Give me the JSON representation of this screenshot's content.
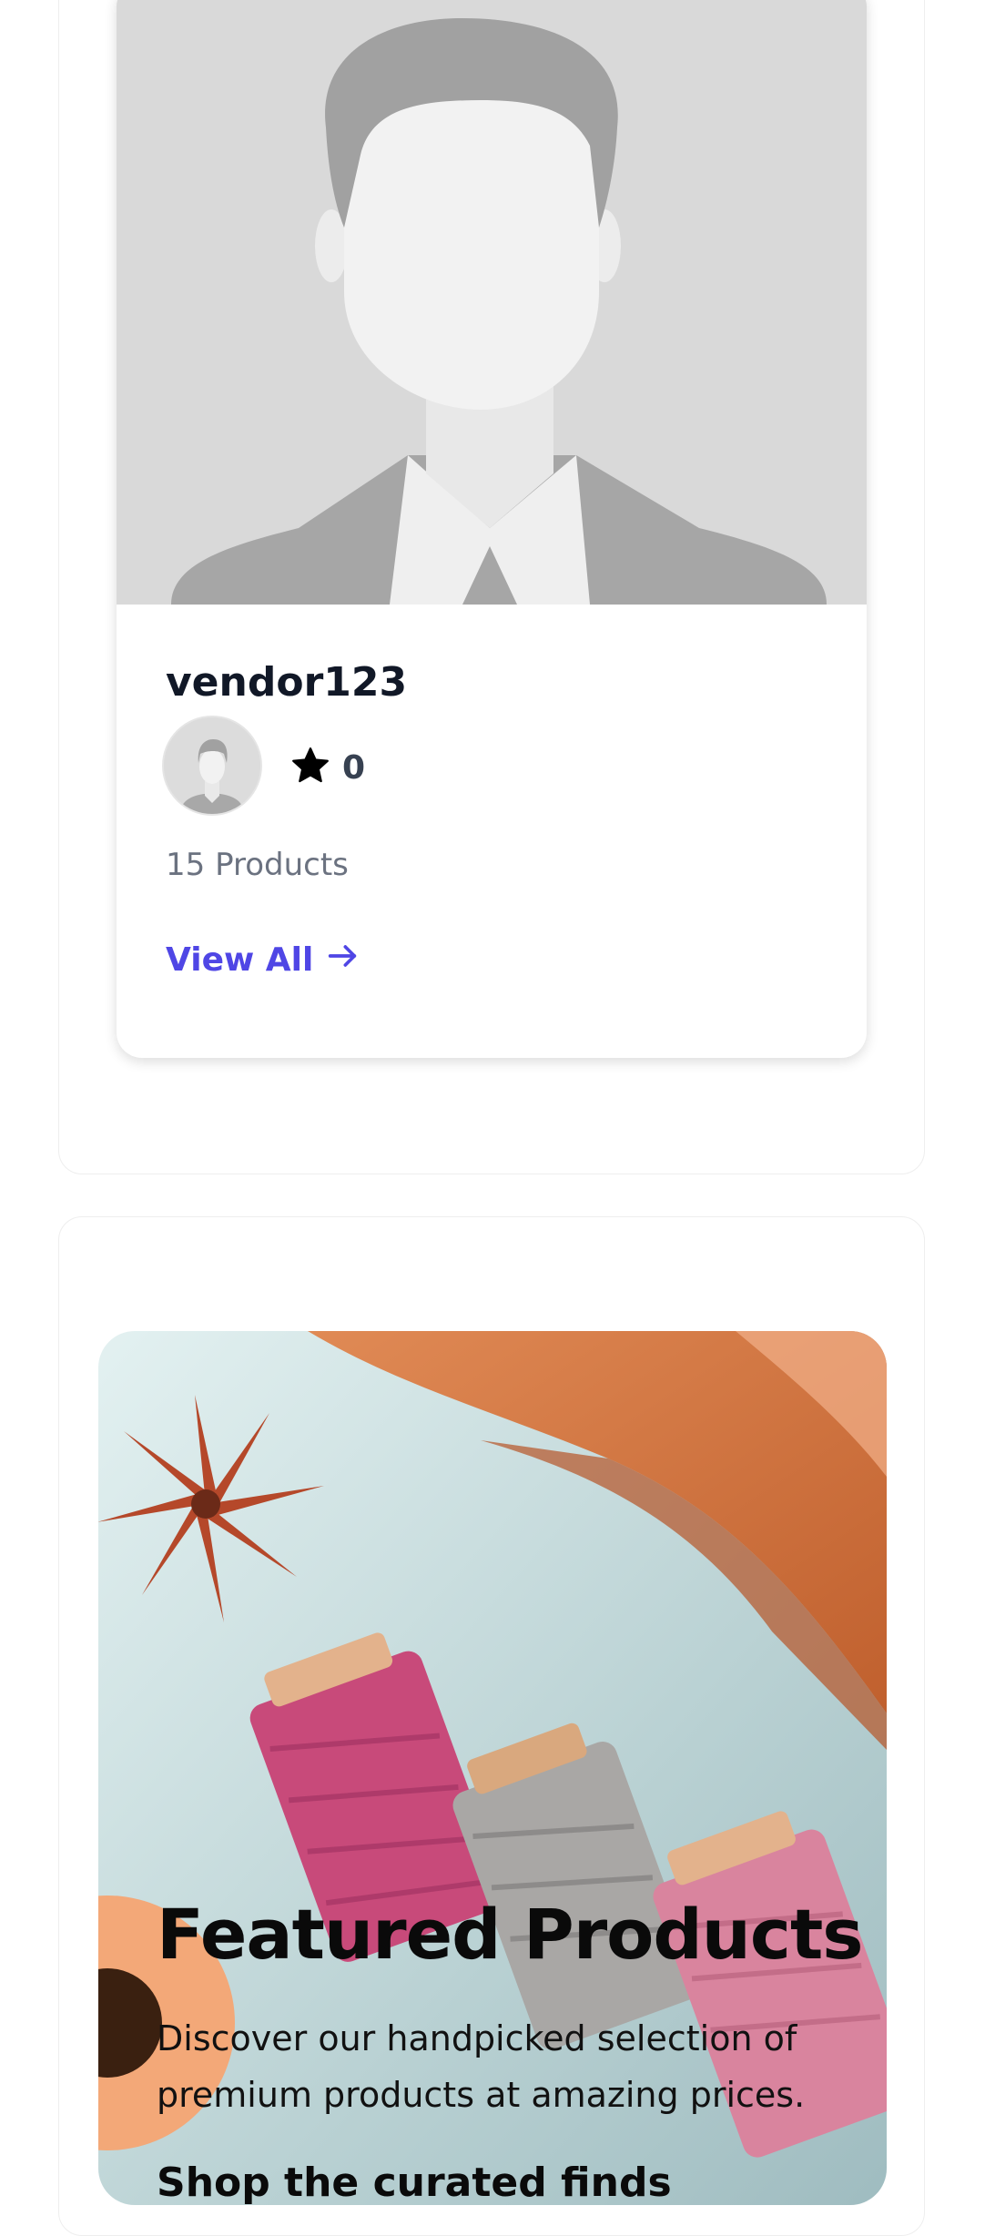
{
  "vendor": {
    "name": "vendor123",
    "rating": "0",
    "products": "15 Products",
    "view_all_label": "View All"
  },
  "featured": {
    "title": "Featured Products",
    "description": "Discover our handpicked selection of premium products at amazing prices.",
    "cta": "Shop the curated finds"
  },
  "icons": {
    "rating": "star-icon",
    "view_all": "arrow-right-icon",
    "vendor_image": "person-placeholder-icon"
  },
  "colors": {
    "accent": "#4f46e5",
    "heading": "#111827",
    "muted": "#6b7280",
    "placeholder_bg": "#d9d9d9"
  }
}
